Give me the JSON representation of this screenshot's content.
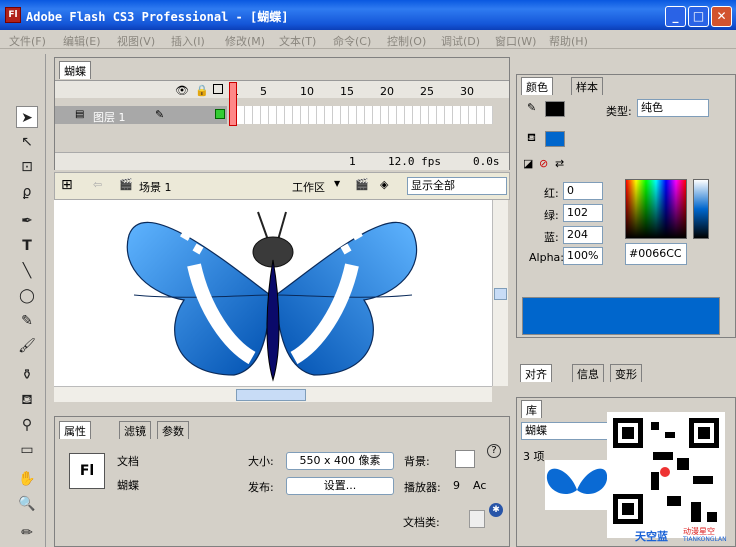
{
  "window": {
    "title": "Adobe Flash CS3 Professional - [蝴蝶]",
    "app_icon": "Fl",
    "min": "_",
    "max": "□",
    "close": "✕"
  },
  "menu": [
    "文件(F)",
    "编辑(E)",
    "视图(V)",
    "插入(I)",
    "修改(M)",
    "文本(T)",
    "命令(C)",
    "控制(O)",
    "调试(D)",
    "窗口(W)",
    "帮助(H)"
  ],
  "timeline": {
    "doc_tab": "蝴蝶",
    "layer_name": "图层 1",
    "frame_numbers": [
      "1",
      "5",
      "10",
      "15",
      "20",
      "25",
      "30"
    ],
    "current_frame": "1",
    "fps": "12.0 fps",
    "time": "0.0s"
  },
  "stage_bar": {
    "scene": "场景 1",
    "workspace": "工作区",
    "zoom": "显示全部"
  },
  "properties": {
    "tabs": [
      "属性",
      "滤镜",
      "参数"
    ],
    "doc_label": "文档",
    "doc_name": "蝴蝶",
    "fl_icon": "Fl",
    "size_label": "大小:",
    "size_value": "550 x 400 像素",
    "bg_label": "背景:",
    "publish_label": "发布:",
    "settings_btn": "设置...",
    "player_label": "播放器:",
    "player_value": "9",
    "as_label": "Ac",
    "doc_class_label": "文档类:",
    "help": "?"
  },
  "color_panel": {
    "tabs": [
      "颜色",
      "样本"
    ],
    "type_label": "类型:",
    "type_value": "纯色",
    "r_label": "红:",
    "r_value": "0",
    "g_label": "绿:",
    "g_value": "102",
    "b_label": "蓝:",
    "b_value": "204",
    "alpha_label": "Alpha:",
    "alpha_value": "100%",
    "hex_value": "#0066CC",
    "fill_color": "#0066CC"
  },
  "align_panel": {
    "tabs": [
      "对齐",
      "信息",
      "变形"
    ]
  },
  "library": {
    "tab": "库",
    "doc": "蝴蝶",
    "count": "3 项"
  },
  "watermark": {
    "brand": "天空蓝",
    "sub": "动漫星空",
    "url": "TIANKONGLAN"
  }
}
